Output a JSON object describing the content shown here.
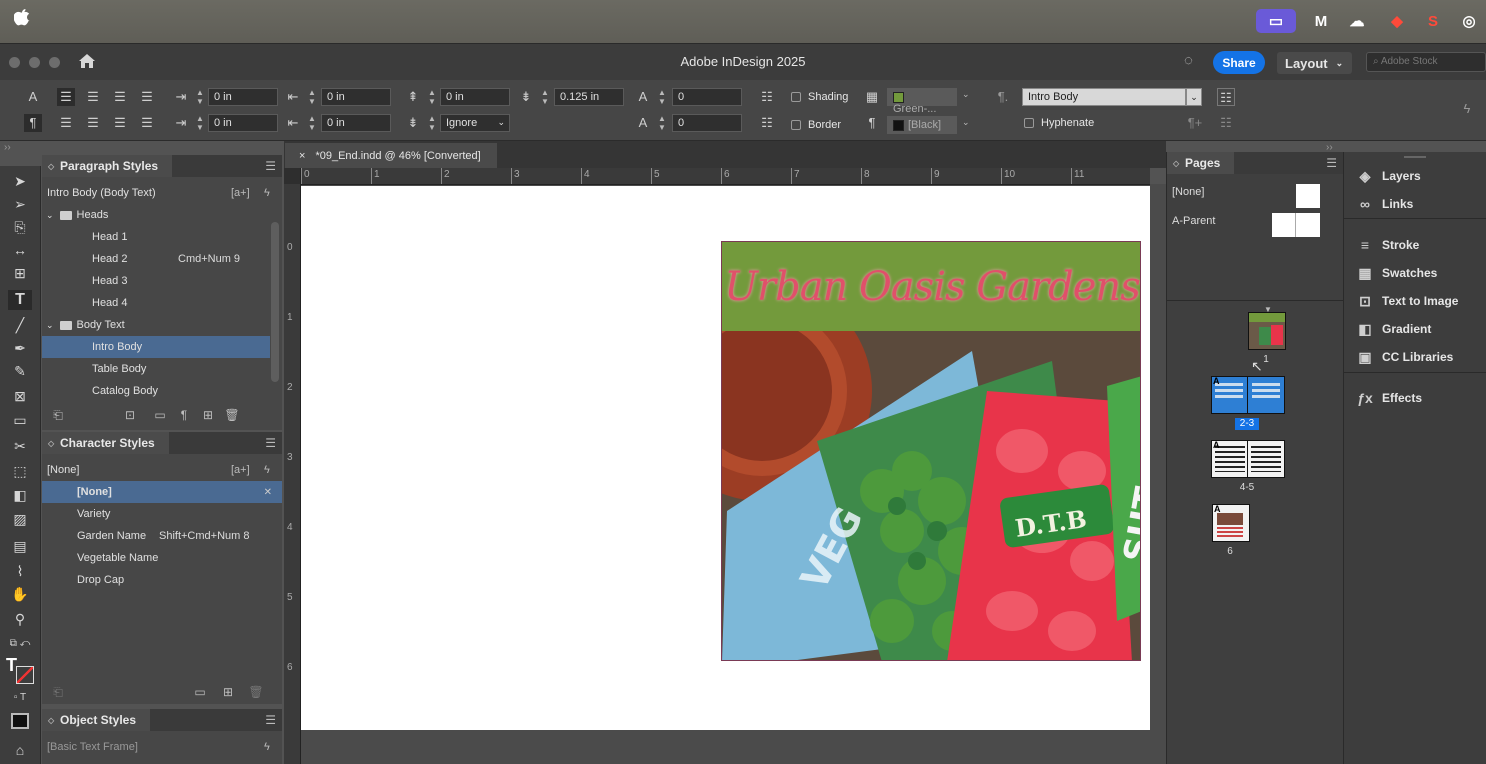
{
  "menubar": {
    "apple": "",
    "tray_icons": [
      "screen-share-icon",
      "malwarebytes-icon",
      "cloud-sync-icon",
      "dropbox-icon",
      "sketch-s-icon",
      "airdrop-icon"
    ]
  },
  "titlebar": {
    "title": "Adobe InDesign 2025",
    "share_label": "Share",
    "workspace": "Layout",
    "stock_placeholder": "Adobe Stock"
  },
  "control": {
    "left_indent": "0 in",
    "right_indent": "0 in",
    "first_line_indent": "0 in",
    "last_line_indent": "0 in",
    "space_before": "0 in",
    "space_after": "0 in",
    "space_before_2": "0.125 in",
    "drop_cap_lines": "0",
    "align_grid": "Ignore",
    "drop_cap_chars": "0",
    "shading_label": "Shading",
    "border_label": "Border",
    "shading_swatch": "Green-...",
    "border_swatch": "[Black]",
    "style_select": "Intro Body",
    "hyphenate_label": "Hyphenate"
  },
  "doc_tab": {
    "title": "*09_End.indd @ 46% [Converted]",
    "close": "×"
  },
  "paragraph_styles": {
    "title": "Paragraph Styles",
    "current": "Intro Body (Body Text)",
    "items": [
      {
        "label": "Heads",
        "level": 0,
        "folder": true,
        "shortcut": ""
      },
      {
        "label": "Head 1",
        "level": 1,
        "shortcut": ""
      },
      {
        "label": "Head 2",
        "level": 1,
        "shortcut": "Cmd+Num 9"
      },
      {
        "label": "Head 3",
        "level": 1,
        "shortcut": ""
      },
      {
        "label": "Head 4",
        "level": 1,
        "shortcut": ""
      },
      {
        "label": "Body Text",
        "level": 0,
        "folder": true,
        "shortcut": ""
      },
      {
        "label": "Intro Body",
        "level": 1,
        "shortcut": "",
        "selected": true
      },
      {
        "label": "Table Body",
        "level": 1,
        "shortcut": ""
      },
      {
        "label": "Catalog Body",
        "level": 1,
        "shortcut": ""
      }
    ]
  },
  "character_styles": {
    "title": "Character Styles",
    "current": "[None]",
    "items": [
      {
        "label": "[None]",
        "shortcut": "",
        "selected": true
      },
      {
        "label": "Variety",
        "shortcut": ""
      },
      {
        "label": "Garden Name",
        "shortcut": "Shift+Cmd+Num 8"
      },
      {
        "label": "Vegetable Name",
        "shortcut": ""
      },
      {
        "label": "Drop Cap",
        "shortcut": ""
      }
    ]
  },
  "object_styles": {
    "title": "Object Styles",
    "current": "[Basic Text Frame]"
  },
  "ruler": {
    "h": [
      "0",
      "1",
      "2",
      "3",
      "4",
      "5",
      "6",
      "7",
      "8",
      "9",
      "10",
      "11"
    ],
    "v": [
      "0",
      "1",
      "2",
      "3",
      "4",
      "5",
      "6"
    ]
  },
  "document": {
    "headline": "Urban Oasis Gardens",
    "packet_brand": "D.T.B",
    "packet_text_1": "VEG",
    "packet_text_2": "SUT"
  },
  "pages_panel": {
    "title": "Pages",
    "masters": [
      {
        "label": "[None]"
      },
      {
        "label": "A-Parent"
      }
    ],
    "spreads": [
      {
        "label": "1",
        "selected": false
      },
      {
        "label": "2-3",
        "selected": true
      },
      {
        "label": "4-5",
        "selected": false
      },
      {
        "label": "6",
        "selected": false
      }
    ],
    "master_letter": "A"
  },
  "right_panels": [
    {
      "label": "Layers",
      "icon": "layers-icon"
    },
    {
      "label": "Links",
      "icon": "links-icon"
    },
    {
      "label": "Stroke",
      "icon": "stroke-icon"
    },
    {
      "label": "Swatches",
      "icon": "swatches-icon"
    },
    {
      "label": "Text to Image",
      "icon": "text-to-image-icon"
    },
    {
      "label": "Gradient",
      "icon": "gradient-icon"
    },
    {
      "label": "CC Libraries",
      "icon": "cc-libraries-icon"
    },
    {
      "label": "Effects",
      "icon": "effects-icon"
    }
  ],
  "colors": {
    "accent": "#1473e6",
    "selection": "#4a6a92",
    "banner": "#739a3c",
    "headline": "#e0506a"
  }
}
